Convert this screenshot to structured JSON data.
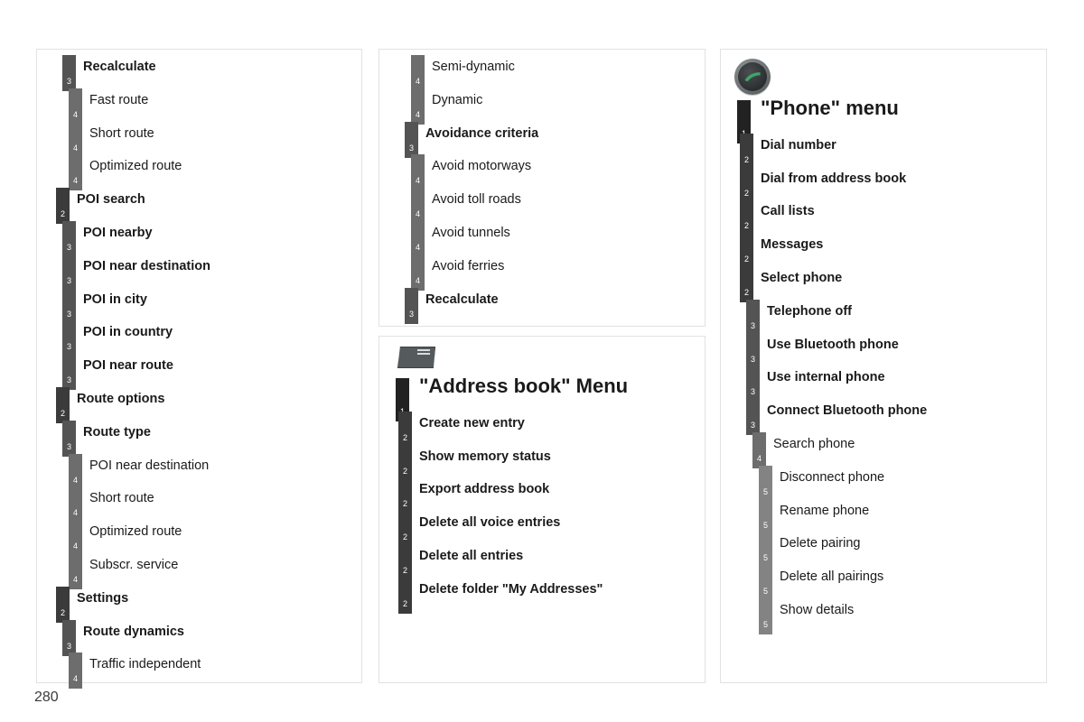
{
  "page": {
    "number": "280"
  },
  "panels": [
    {
      "id": "nav-left",
      "name": "navigation-menu-continued-left",
      "icon": null,
      "rows": [
        {
          "level": 3,
          "label": "Recalculate"
        },
        {
          "level": 4,
          "label": "Fast route"
        },
        {
          "level": 4,
          "label": "Short route"
        },
        {
          "level": 4,
          "label": "Optimized route"
        },
        {
          "level": 2,
          "label": "POI search"
        },
        {
          "level": 3,
          "label": "POI nearby"
        },
        {
          "level": 3,
          "label": "POI near destination"
        },
        {
          "level": 3,
          "label": "POI in city"
        },
        {
          "level": 3,
          "label": "POI in country"
        },
        {
          "level": 3,
          "label": "POI near route"
        },
        {
          "level": 2,
          "label": "Route options"
        },
        {
          "level": 3,
          "label": "Route type"
        },
        {
          "level": 4,
          "label": "POI near destination"
        },
        {
          "level": 4,
          "label": "Short route"
        },
        {
          "level": 4,
          "label": "Optimized route"
        },
        {
          "level": 4,
          "label": "Subscr. service"
        },
        {
          "level": 2,
          "label": "Settings"
        },
        {
          "level": 3,
          "label": "Route dynamics"
        },
        {
          "level": 4,
          "label": "Traffic independent"
        }
      ]
    },
    {
      "id": "nav-mid",
      "name": "navigation-menu-continued-middle",
      "icon": null,
      "rows": [
        {
          "level": 4,
          "label": "Semi-dynamic"
        },
        {
          "level": 4,
          "label": "Dynamic"
        },
        {
          "level": 3,
          "label": "Avoidance criteria"
        },
        {
          "level": 4,
          "label": "Avoid motorways"
        },
        {
          "level": 4,
          "label": "Avoid toll roads"
        },
        {
          "level": 4,
          "label": "Avoid tunnels"
        },
        {
          "level": 4,
          "label": "Avoid ferries"
        },
        {
          "level": 3,
          "label": "Recalculate"
        }
      ]
    },
    {
      "id": "address",
      "name": "address-book-menu",
      "icon": "address-book-icon",
      "rows": [
        {
          "level": 1,
          "label": "\"Address book\" Menu"
        },
        {
          "level": 2,
          "label": "Create new entry"
        },
        {
          "level": 2,
          "label": "Show memory status"
        },
        {
          "level": 2,
          "label": "Export address book"
        },
        {
          "level": 2,
          "label": "Delete all voice entries"
        },
        {
          "level": 2,
          "label": "Delete all entries"
        },
        {
          "level": 2,
          "label": "Delete folder \"My Addresses\""
        }
      ]
    },
    {
      "id": "phone",
      "name": "phone-menu",
      "icon": "phone-call-button-icon",
      "rows": [
        {
          "level": 1,
          "label": "\"Phone\" menu"
        },
        {
          "level": 2,
          "label": "Dial number"
        },
        {
          "level": 2,
          "label": "Dial from address book"
        },
        {
          "level": 2,
          "label": "Call lists"
        },
        {
          "level": 2,
          "label": "Messages"
        },
        {
          "level": 2,
          "label": "Select phone"
        },
        {
          "level": 3,
          "label": "Telephone off"
        },
        {
          "level": 3,
          "label": "Use Bluetooth phone"
        },
        {
          "level": 3,
          "label": "Use internal phone"
        },
        {
          "level": 3,
          "label": "Connect Bluetooth phone"
        },
        {
          "level": 4,
          "label": "Search phone"
        },
        {
          "level": 5,
          "label": "Disconnect phone"
        },
        {
          "level": 5,
          "label": "Rename phone"
        },
        {
          "level": 5,
          "label": "Delete pairing"
        },
        {
          "level": 5,
          "label": "Delete all pairings"
        },
        {
          "level": 5,
          "label": "Show details"
        }
      ]
    }
  ],
  "level_colors": {
    "1": "#222222",
    "2": "#3b3b3b",
    "3": "#545454",
    "4": "#6d6d6d",
    "5": "#838383"
  },
  "accent": {
    "phone_glyph": "#3fa56b",
    "panel_border": "#e2e2e2"
  }
}
